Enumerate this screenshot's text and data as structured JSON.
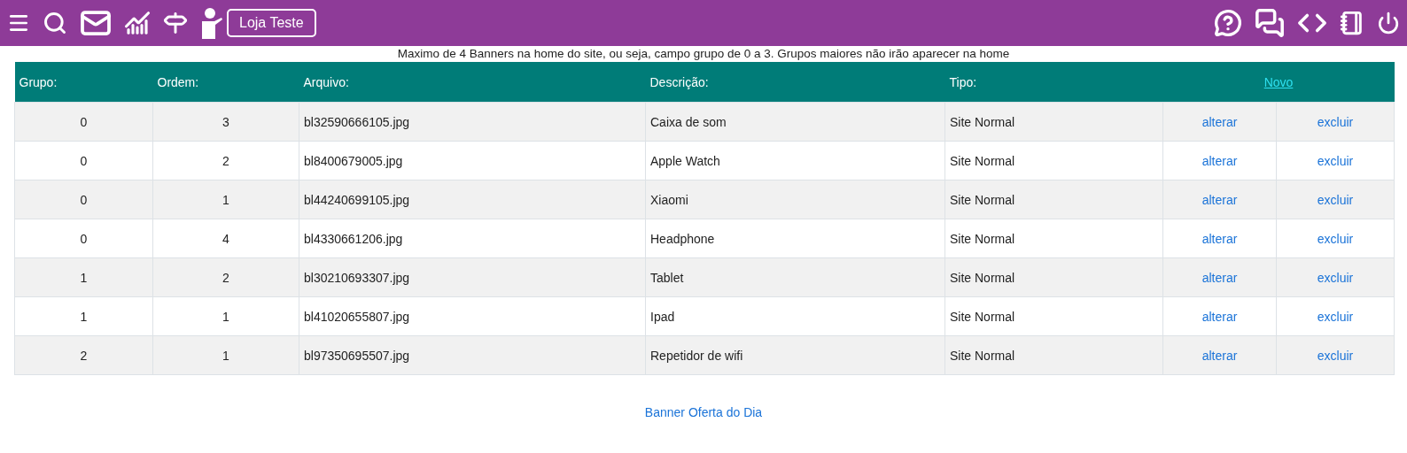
{
  "topbar": {
    "store_button": "Loja Teste"
  },
  "notice": "Maximo de 4 Banners na home do site, ou seja, campo grupo de 0 a 3. Grupos maiores não irão aparecer na home",
  "table": {
    "columns": [
      "Grupo:",
      "Ordem:",
      "Arquivo:",
      "Descrição:",
      "Tipo:"
    ],
    "new_link": "Novo",
    "rows": [
      {
        "grupo": "0",
        "ordem": "3",
        "arquivo": "bl32590666105.jpg",
        "descricao": "Caixa de som",
        "tipo": "Site Normal",
        "edit": "alterar",
        "delete": "excluir"
      },
      {
        "grupo": "0",
        "ordem": "2",
        "arquivo": "bl8400679005.jpg",
        "descricao": "Apple Watch",
        "tipo": "Site Normal",
        "edit": "alterar",
        "delete": "excluir"
      },
      {
        "grupo": "0",
        "ordem": "1",
        "arquivo": "bl44240699105.jpg",
        "descricao": "Xiaomi",
        "tipo": "Site Normal",
        "edit": "alterar",
        "delete": "excluir"
      },
      {
        "grupo": "0",
        "ordem": "4",
        "arquivo": "bl4330661206.jpg",
        "descricao": "Headphone",
        "tipo": "Site Normal",
        "edit": "alterar",
        "delete": "excluir"
      },
      {
        "grupo": "1",
        "ordem": "2",
        "arquivo": "bl30210693307.jpg",
        "descricao": "Tablet",
        "tipo": "Site Normal",
        "edit": "alterar",
        "delete": "excluir"
      },
      {
        "grupo": "1",
        "ordem": "1",
        "arquivo": "bl41020655807.jpg",
        "descricao": "Ipad",
        "tipo": "Site Normal",
        "edit": "alterar",
        "delete": "excluir"
      },
      {
        "grupo": "2",
        "ordem": "1",
        "arquivo": "bl97350695507.jpg",
        "descricao": "Repetidor de wifi",
        "tipo": "Site Normal",
        "edit": "alterar",
        "delete": "excluir"
      }
    ]
  },
  "footer_link": "Banner Oferta do Dia"
}
